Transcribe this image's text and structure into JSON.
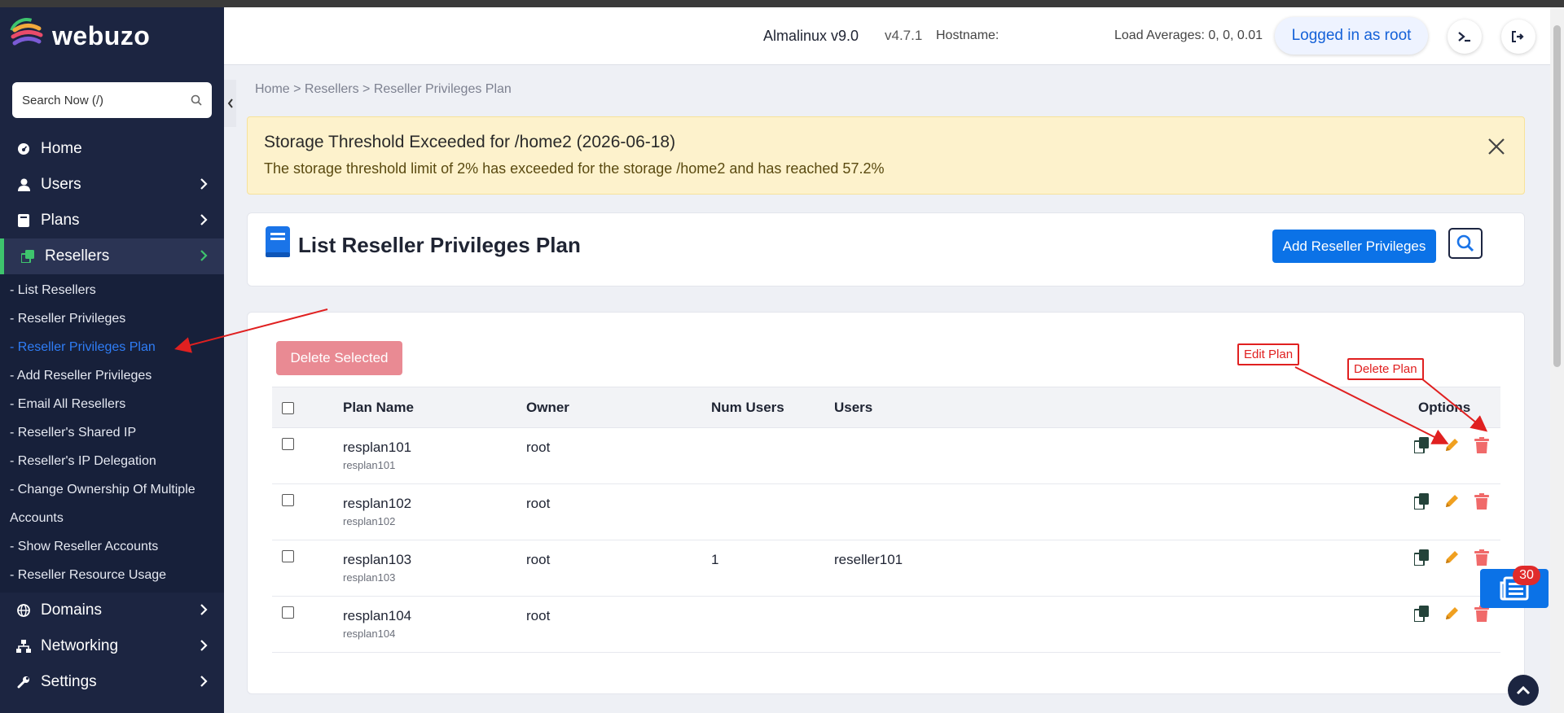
{
  "brand": {
    "name": "webuzo"
  },
  "sidebar": {
    "search_placeholder": "Search Now (/)",
    "items": [
      {
        "label": "Home",
        "icon": "dashboard-icon"
      },
      {
        "label": "Users",
        "icon": "user-icon"
      },
      {
        "label": "Plans",
        "icon": "book-icon"
      },
      {
        "label": "Resellers",
        "icon": "copy-icon"
      }
    ],
    "reseller_sub": [
      "- List Resellers",
      "- Reseller Privileges",
      "- Reseller Privileges Plan",
      "- Add Reseller Privileges",
      "- Email All Resellers",
      "- Reseller's Shared IP",
      "- Reseller's IP Delegation",
      "- Change Ownership Of Multiple",
      "Accounts",
      "- Show Reseller Accounts",
      "- Reseller Resource Usage"
    ],
    "items_after": [
      {
        "label": "Domains",
        "icon": "globe-icon"
      },
      {
        "label": "Networking",
        "icon": "network-icon"
      },
      {
        "label": "Settings",
        "icon": "wrench-icon"
      }
    ]
  },
  "topbar": {
    "os": "Almalinux v9.0",
    "version": "v4.7.1",
    "hostname_label": "Hostname:",
    "load": "Load Averages: 0, 0, 0.01",
    "logged": "Logged in as root"
  },
  "breadcrumb": {
    "home": "Home",
    "sep1": " > ",
    "resellers": "Resellers",
    "sep2": " > ",
    "current": "Reseller Privileges Plan"
  },
  "alert": {
    "title": "Storage Threshold Exceeded for /home2 (2026-06-18)",
    "message": "The storage threshold limit of 2% has exceeded for the storage /home2 and has reached 57.2%"
  },
  "header": {
    "title": "List Reseller Privileges Plan",
    "add_button": "Add Reseller Privileges"
  },
  "table": {
    "delete_selected": "Delete Selected",
    "columns": [
      "Plan Name",
      "Owner",
      "Num Users",
      "Users",
      "Options"
    ],
    "rows": [
      {
        "plan": "resplan101",
        "plan_sub": "resplan101",
        "owner": "root",
        "num_users": "",
        "users": ""
      },
      {
        "plan": "resplan102",
        "plan_sub": "resplan102",
        "owner": "root",
        "num_users": "",
        "users": ""
      },
      {
        "plan": "resplan103",
        "plan_sub": "resplan103",
        "owner": "root",
        "num_users": "1",
        "users": "reseller101"
      },
      {
        "plan": "resplan104",
        "plan_sub": "resplan104",
        "owner": "root",
        "num_users": "",
        "users": ""
      }
    ]
  },
  "annotations": {
    "edit": "Edit Plan",
    "delete": "Delete Plan"
  },
  "float": {
    "count": "30"
  },
  "colors": {
    "sidebar": "#1c2541",
    "primary": "#0b72e7",
    "active_accent": "#3ec46d",
    "annotation": "#e02020",
    "edit": "#f0a020",
    "delete": "#f06a6a"
  }
}
